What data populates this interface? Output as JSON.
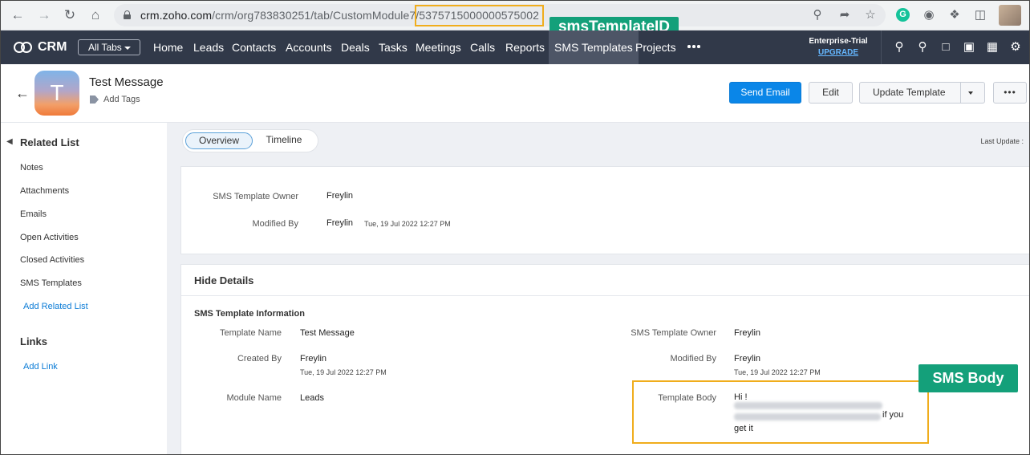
{
  "browser": {
    "url_host": "crm.zoho.com",
    "url_path": "/crm/org783830251/tab/CustomModule7/",
    "url_id": "5375715000000575002"
  },
  "annotations": {
    "template_id_label": "smsTemplateID",
    "sms_body_label": "SMS Body",
    "highlight_color": "#f0ad1c",
    "label_color": "#14a07a"
  },
  "topnav": {
    "brand": "CRM",
    "all_tabs": "All Tabs",
    "tabs": [
      "Home",
      "Leads",
      "Contacts",
      "Accounts",
      "Deals",
      "Tasks",
      "Meetings",
      "Calls",
      "Reports",
      "SMS Templates",
      "Projects"
    ],
    "active_tab": "SMS Templates",
    "trial_label": "Enterprise-Trial",
    "upgrade_label": "UPGRADE",
    "background": "#313949"
  },
  "record": {
    "avatar_letter": "T",
    "title": "Test Message",
    "add_tags": "Add Tags",
    "buttons": {
      "send_email": "Send Email",
      "edit": "Edit",
      "update_template": "Update Template"
    }
  },
  "sidebar": {
    "related_list_title": "Related List",
    "items": [
      "Notes",
      "Attachments",
      "Emails",
      "Open Activities",
      "Closed Activities",
      "SMS Templates"
    ],
    "add_related_list": "Add Related List",
    "links_title": "Links",
    "add_link": "Add Link"
  },
  "main": {
    "tabs": {
      "overview": "Overview",
      "timeline": "Timeline"
    },
    "last_update": "Last Update :",
    "summary": {
      "owner_label": "SMS Template Owner",
      "owner_value": "Freylin",
      "modified_label": "Modified By",
      "modified_value": "Freylin",
      "modified_time": "Tue, 19 Jul 2022 12:27 PM"
    },
    "details": {
      "hide_details": "Hide Details",
      "section_title": "SMS Template Information",
      "template_name_label": "Template Name",
      "template_name_value": "Test Message",
      "created_by_label": "Created By",
      "created_by_value": "Freylin",
      "created_time": "Tue, 19 Jul 2022 12:27 PM",
      "module_name_label": "Module Name",
      "module_name_value": "Leads",
      "owner_label": "SMS Template Owner",
      "owner_value": "Freylin",
      "modified_label": "Modified By",
      "modified_value": "Freylin",
      "modified_time": "Tue, 19 Jul 2022 12:27 PM",
      "body_label": "Template Body",
      "body_line1": "Hi !",
      "body_line2_tail": "if you",
      "body_line3": "get it"
    }
  }
}
